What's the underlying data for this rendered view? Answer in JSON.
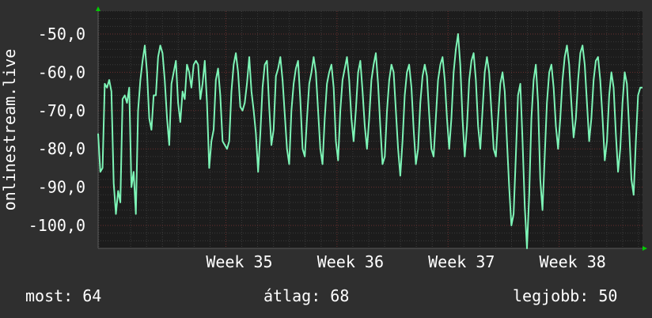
{
  "chart_data": {
    "type": "line",
    "ylabel": "onlinestream.live",
    "ylim": [
      -106,
      -44
    ],
    "yticks": [
      -50,
      -60,
      -70,
      -80,
      -90,
      -100
    ],
    "ytick_labels": [
      "-50,0",
      "-60,0",
      "-70,0",
      "-80,0",
      "-90,0",
      "-100,0"
    ],
    "x_range": [
      -1.15,
      3.75
    ],
    "xticks": [
      0,
      1,
      2,
      3
    ],
    "xtick_labels": [
      "Week 35",
      "Week 36",
      "Week 37",
      "Week 38"
    ],
    "grid": true,
    "colors": {
      "background": "#2f2f2f",
      "plot_area": "#1c1c1c",
      "grid_minor": "#3a3a3a",
      "grid_major": "#6a2f2f",
      "line": "#7df4b6",
      "axis_arrow": "#00cc00"
    },
    "series": [
      {
        "values": [
          [
            -1.15,
            -76
          ],
          [
            -1.13,
            -86
          ],
          [
            -1.11,
            -85
          ],
          [
            -1.09,
            -63
          ],
          [
            -1.07,
            -64
          ],
          [
            -1.05,
            -62
          ],
          [
            -1.03,
            -65
          ],
          [
            -1.01,
            -89
          ],
          [
            -0.99,
            -97
          ],
          [
            -0.97,
            -91
          ],
          [
            -0.95,
            -94
          ],
          [
            -0.93,
            -67
          ],
          [
            -0.91,
            -66
          ],
          [
            -0.89,
            -68
          ],
          [
            -0.87,
            -64
          ],
          [
            -0.85,
            -90
          ],
          [
            -0.83,
            -86
          ],
          [
            -0.81,
            -97
          ],
          [
            -0.79,
            -70
          ],
          [
            -0.77,
            -62
          ],
          [
            -0.75,
            -57
          ],
          [
            -0.73,
            -53
          ],
          [
            -0.71,
            -60
          ],
          [
            -0.69,
            -72
          ],
          [
            -0.67,
            -75
          ],
          [
            -0.65,
            -66
          ],
          [
            -0.63,
            -66
          ],
          [
            -0.61,
            -56
          ],
          [
            -0.59,
            -53
          ],
          [
            -0.57,
            -55
          ],
          [
            -0.55,
            -62
          ],
          [
            -0.53,
            -72
          ],
          [
            -0.51,
            -79
          ],
          [
            -0.49,
            -63
          ],
          [
            -0.47,
            -60
          ],
          [
            -0.45,
            -57
          ],
          [
            -0.43,
            -68
          ],
          [
            -0.41,
            -73
          ],
          [
            -0.39,
            -65
          ],
          [
            -0.37,
            -67
          ],
          [
            -0.35,
            -58
          ],
          [
            -0.33,
            -60
          ],
          [
            -0.31,
            -64
          ],
          [
            -0.29,
            -58
          ],
          [
            -0.27,
            -57
          ],
          [
            -0.25,
            -58
          ],
          [
            -0.23,
            -67
          ],
          [
            -0.21,
            -63
          ],
          [
            -0.19,
            -57
          ],
          [
            -0.17,
            -68
          ],
          [
            -0.15,
            -85
          ],
          [
            -0.13,
            -78
          ],
          [
            -0.11,
            -75
          ],
          [
            -0.09,
            -62
          ],
          [
            -0.07,
            -59
          ],
          [
            -0.05,
            -66
          ],
          [
            -0.03,
            -78
          ],
          [
            -0.01,
            -79
          ],
          [
            0.01,
            -80
          ],
          [
            0.03,
            -78
          ],
          [
            0.05,
            -65
          ],
          [
            0.07,
            -58
          ],
          [
            0.09,
            -55
          ],
          [
            0.11,
            -60
          ],
          [
            0.13,
            -69
          ],
          [
            0.15,
            -70
          ],
          [
            0.17,
            -68
          ],
          [
            0.19,
            -63
          ],
          [
            0.21,
            -56
          ],
          [
            0.23,
            -65
          ],
          [
            0.25,
            -70
          ],
          [
            0.27,
            -76
          ],
          [
            0.29,
            -86
          ],
          [
            0.31,
            -76
          ],
          [
            0.33,
            -64
          ],
          [
            0.35,
            -58
          ],
          [
            0.37,
            -57
          ],
          [
            0.39,
            -69
          ],
          [
            0.41,
            -79
          ],
          [
            0.43,
            -75
          ],
          [
            0.45,
            -61
          ],
          [
            0.47,
            -59
          ],
          [
            0.49,
            -56
          ],
          [
            0.51,
            -62
          ],
          [
            0.53,
            -71
          ],
          [
            0.55,
            -80
          ],
          [
            0.57,
            -84
          ],
          [
            0.59,
            -70
          ],
          [
            0.61,
            -63
          ],
          [
            0.63,
            -59
          ],
          [
            0.65,
            -57
          ],
          [
            0.67,
            -67
          ],
          [
            0.69,
            -80
          ],
          [
            0.71,
            -82
          ],
          [
            0.73,
            -72
          ],
          [
            0.75,
            -63
          ],
          [
            0.77,
            -60
          ],
          [
            0.79,
            -56
          ],
          [
            0.81,
            -60
          ],
          [
            0.83,
            -70
          ],
          [
            0.85,
            -80
          ],
          [
            0.87,
            -84
          ],
          [
            0.89,
            -72
          ],
          [
            0.91,
            -63
          ],
          [
            0.93,
            -60
          ],
          [
            0.95,
            -58
          ],
          [
            0.97,
            -64
          ],
          [
            0.99,
            -78
          ],
          [
            1.01,
            -83
          ],
          [
            1.03,
            -70
          ],
          [
            1.05,
            -62
          ],
          [
            1.07,
            -59
          ],
          [
            1.09,
            -56
          ],
          [
            1.11,
            -62
          ],
          [
            1.13,
            -72
          ],
          [
            1.15,
            -78
          ],
          [
            1.17,
            -70
          ],
          [
            1.19,
            -60
          ],
          [
            1.21,
            -57
          ],
          [
            1.23,
            -65
          ],
          [
            1.25,
            -74
          ],
          [
            1.27,
            -80
          ],
          [
            1.29,
            -72
          ],
          [
            1.31,
            -62
          ],
          [
            1.33,
            -58
          ],
          [
            1.35,
            -55
          ],
          [
            1.37,
            -63
          ],
          [
            1.39,
            -74
          ],
          [
            1.41,
            -84
          ],
          [
            1.43,
            -82
          ],
          [
            1.45,
            -70
          ],
          [
            1.47,
            -62
          ],
          [
            1.49,
            -58
          ],
          [
            1.51,
            -60
          ],
          [
            1.53,
            -70
          ],
          [
            1.55,
            -80
          ],
          [
            1.57,
            -87
          ],
          [
            1.59,
            -78
          ],
          [
            1.61,
            -66
          ],
          [
            1.63,
            -60
          ],
          [
            1.65,
            -58
          ],
          [
            1.67,
            -64
          ],
          [
            1.69,
            -75
          ],
          [
            1.71,
            -84
          ],
          [
            1.73,
            -80
          ],
          [
            1.75,
            -68
          ],
          [
            1.77,
            -61
          ],
          [
            1.79,
            -58
          ],
          [
            1.81,
            -61
          ],
          [
            1.83,
            -71
          ],
          [
            1.85,
            -80
          ],
          [
            1.87,
            -82
          ],
          [
            1.89,
            -72
          ],
          [
            1.91,
            -62
          ],
          [
            1.93,
            -58
          ],
          [
            1.95,
            -56
          ],
          [
            1.97,
            -62
          ],
          [
            1.99,
            -72
          ],
          [
            2.01,
            -80
          ],
          [
            2.03,
            -72
          ],
          [
            2.05,
            -60
          ],
          [
            2.07,
            -54
          ],
          [
            2.09,
            -50
          ],
          [
            2.11,
            -58
          ],
          [
            2.13,
            -72
          ],
          [
            2.15,
            -82
          ],
          [
            2.17,
            -74
          ],
          [
            2.19,
            -62
          ],
          [
            2.21,
            -57
          ],
          [
            2.23,
            -55
          ],
          [
            2.25,
            -62
          ],
          [
            2.27,
            -74
          ],
          [
            2.29,
            -80
          ],
          [
            2.31,
            -70
          ],
          [
            2.33,
            -60
          ],
          [
            2.35,
            -56
          ],
          [
            2.37,
            -60
          ],
          [
            2.39,
            -70
          ],
          [
            2.41,
            -80
          ],
          [
            2.43,
            -82
          ],
          [
            2.45,
            -72
          ],
          [
            2.47,
            -63
          ],
          [
            2.49,
            -60
          ],
          [
            2.51,
            -65
          ],
          [
            2.53,
            -78
          ],
          [
            2.55,
            -90
          ],
          [
            2.57,
            -100
          ],
          [
            2.59,
            -97
          ],
          [
            2.61,
            -82
          ],
          [
            2.63,
            -66
          ],
          [
            2.65,
            -63
          ],
          [
            2.67,
            -78
          ],
          [
            2.69,
            -95
          ],
          [
            2.71,
            -106
          ],
          [
            2.73,
            -92
          ],
          [
            2.75,
            -72
          ],
          [
            2.77,
            -62
          ],
          [
            2.79,
            -58
          ],
          [
            2.81,
            -68
          ],
          [
            2.83,
            -88
          ],
          [
            2.85,
            -96
          ],
          [
            2.87,
            -82
          ],
          [
            2.89,
            -68
          ],
          [
            2.91,
            -60
          ],
          [
            2.93,
            -58
          ],
          [
            2.95,
            -64
          ],
          [
            2.97,
            -74
          ],
          [
            2.99,
            -80
          ],
          [
            3.01,
            -72
          ],
          [
            3.03,
            -62
          ],
          [
            3.05,
            -56
          ],
          [
            3.07,
            -53
          ],
          [
            3.09,
            -58
          ],
          [
            3.11,
            -68
          ],
          [
            3.13,
            -77
          ],
          [
            3.15,
            -72
          ],
          [
            3.17,
            -62
          ],
          [
            3.19,
            -55
          ],
          [
            3.21,
            -53
          ],
          [
            3.23,
            -58
          ],
          [
            3.25,
            -68
          ],
          [
            3.27,
            -78
          ],
          [
            3.29,
            -72
          ],
          [
            3.31,
            -62
          ],
          [
            3.33,
            -57
          ],
          [
            3.35,
            -56
          ],
          [
            3.37,
            -62
          ],
          [
            3.39,
            -72
          ],
          [
            3.41,
            -83
          ],
          [
            3.43,
            -78
          ],
          [
            3.45,
            -66
          ],
          [
            3.47,
            -60
          ],
          [
            3.49,
            -64
          ],
          [
            3.51,
            -76
          ],
          [
            3.53,
            -86
          ],
          [
            3.55,
            -80
          ],
          [
            3.57,
            -68
          ],
          [
            3.59,
            -60
          ],
          [
            3.61,
            -63
          ],
          [
            3.63,
            -75
          ],
          [
            3.65,
            -88
          ],
          [
            3.67,
            -92
          ],
          [
            3.69,
            -78
          ],
          [
            3.71,
            -66
          ],
          [
            3.73,
            -64
          ],
          [
            3.75,
            -64
          ]
        ]
      }
    ]
  },
  "stats": {
    "current": "most: 64",
    "average": "átlag: 68",
    "best": "legjobb: 50"
  }
}
